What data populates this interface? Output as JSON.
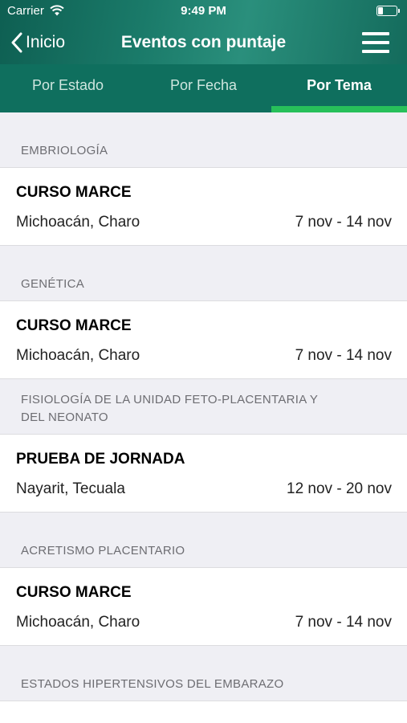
{
  "status_bar": {
    "carrier": "Carrier",
    "time": "9:49 PM",
    "battery_level": 0.25
  },
  "nav": {
    "back_label": "Inicio",
    "title": "Eventos con puntaje"
  },
  "tabs": [
    {
      "label": "Por Estado",
      "active": false
    },
    {
      "label": "Por Fecha",
      "active": false
    },
    {
      "label": "Por Tema",
      "active": true
    }
  ],
  "sections": [
    {
      "header": "EMBRIOLOGÍA",
      "event": {
        "title": "CURSO MARCE",
        "location": "Michoacán, Charo",
        "dates": "7 nov - 14 nov"
      }
    },
    {
      "header": "GENÉTICA",
      "event": {
        "title": "CURSO MARCE",
        "location": "Michoacán, Charo",
        "dates": "7 nov - 14 nov"
      }
    },
    {
      "header": "FISIOLOGÍA DE LA UNIDAD FETO-PLACENTARIA Y DEL NEONATO",
      "event": {
        "title": "PRUEBA DE JORNADA",
        "location": "Nayarit, Tecuala",
        "dates": "12 nov - 20 nov"
      }
    },
    {
      "header": "ACRETISMO PLACENTARIO",
      "event": {
        "title": "CURSO MARCE",
        "location": "Michoacán, Charo",
        "dates": "7 nov - 14 nov"
      }
    },
    {
      "header": "ESTADOS HIPERTENSIVOS DEL EMBARAZO",
      "event": null
    }
  ],
  "colors": {
    "header_bg": "#0f6f5e",
    "tab_indicator": "#27c05a",
    "list_bg": "#efeff4"
  }
}
